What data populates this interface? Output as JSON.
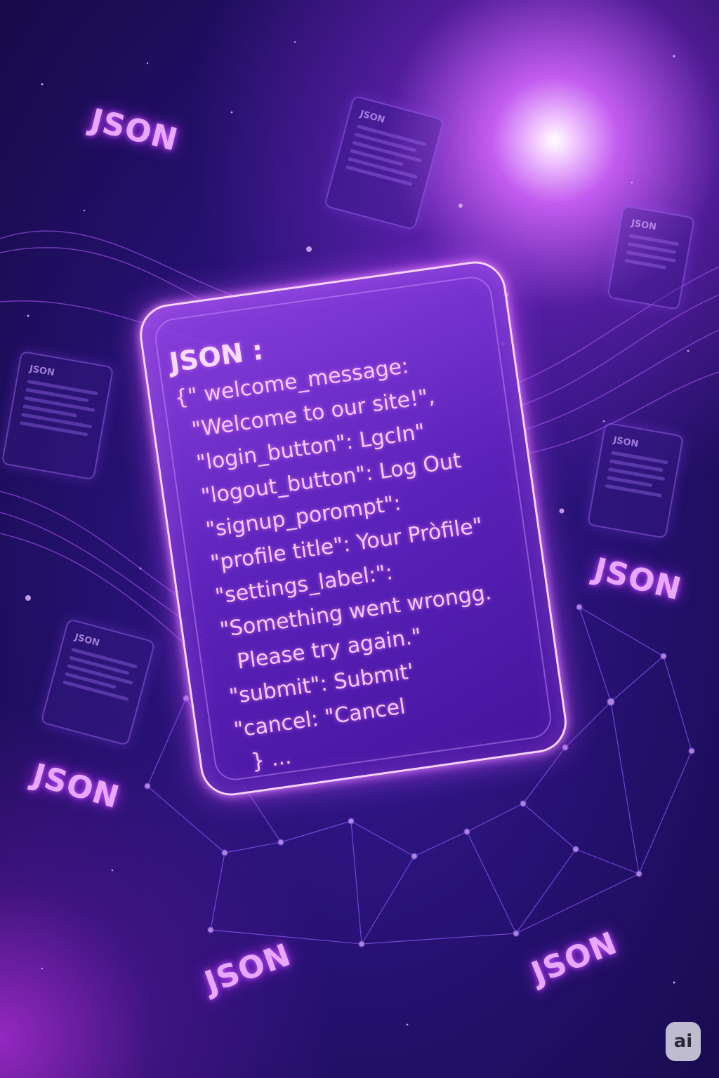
{
  "tags": [
    "JSON",
    "JSON",
    "JSON",
    "JSON",
    "JSON"
  ],
  "card": {
    "title": "JSON :",
    "lines": [
      "{\" welcome_message:",
      "\"Welcome to our site!\",",
      "\"login_button\": LgcIn\"",
      "\"logout_button\": Log Out",
      "\"signup_porompt\":",
      "\"profile title\": Your Pròfile\"",
      "\"settings_label:\":",
      "\"Something went wrongg.",
      "Please try again.\"",
      "\"submit\": Submıt'",
      "\"cancel: \"Cancel",
      "} ..."
    ]
  },
  "badge": {
    "label": "ai"
  },
  "colors": {
    "accent": "#e9a8ff",
    "glow": "#c34cff",
    "background": "#22106a"
  }
}
